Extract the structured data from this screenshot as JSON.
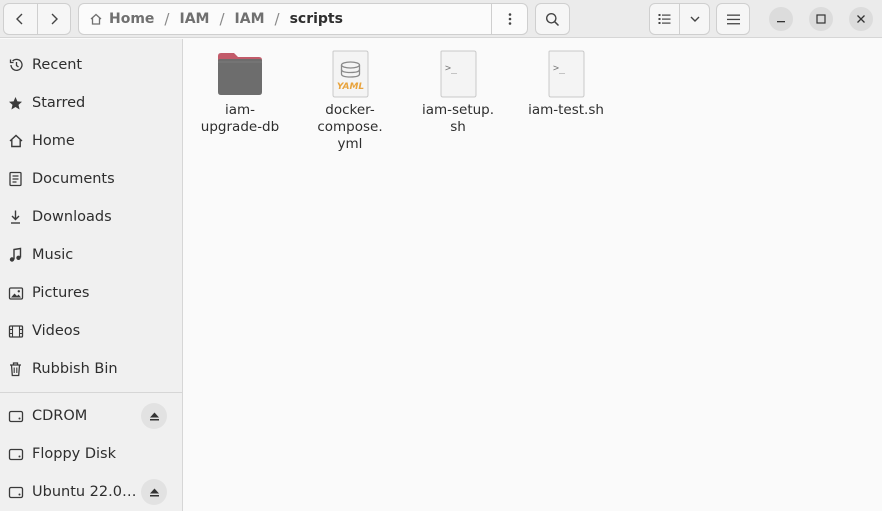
{
  "pathbar": {
    "crumbs": [
      "Home",
      "IAM",
      "IAM",
      "scripts"
    ],
    "separator": "/"
  },
  "sidebar": {
    "places": [
      {
        "label": "Recent",
        "icon": "clock-icon"
      },
      {
        "label": "Starred",
        "icon": "star-icon"
      },
      {
        "label": "Home",
        "icon": "home-icon"
      },
      {
        "label": "Documents",
        "icon": "document-icon"
      },
      {
        "label": "Downloads",
        "icon": "download-icon"
      },
      {
        "label": "Music",
        "icon": "music-icon"
      },
      {
        "label": "Pictures",
        "icon": "picture-icon"
      },
      {
        "label": "Videos",
        "icon": "video-icon"
      },
      {
        "label": "Rubbish Bin",
        "icon": "trash-icon"
      }
    ],
    "devices": [
      {
        "label": "CDROM",
        "icon": "disc-icon",
        "ejectable": true
      },
      {
        "label": "Floppy Disk",
        "icon": "drive-icon",
        "ejectable": false
      },
      {
        "label": "Ubuntu 22.0…",
        "icon": "disc-icon",
        "ejectable": true
      }
    ]
  },
  "files": [
    {
      "name": "iam-\nupgrade-db",
      "type": "folder"
    },
    {
      "name": "docker-\ncompose.\nyml",
      "type": "yaml",
      "badge": "YAML"
    },
    {
      "name": "iam-setup.\nsh",
      "type": "script",
      "badge": ">_"
    },
    {
      "name": "iam-test.sh",
      "type": "script",
      "badge": ">_"
    }
  ],
  "colors": {
    "folder_tab": "#c25b6a",
    "folder_body": "#6d6d6d",
    "yaml_accent": "#e8a33d"
  }
}
